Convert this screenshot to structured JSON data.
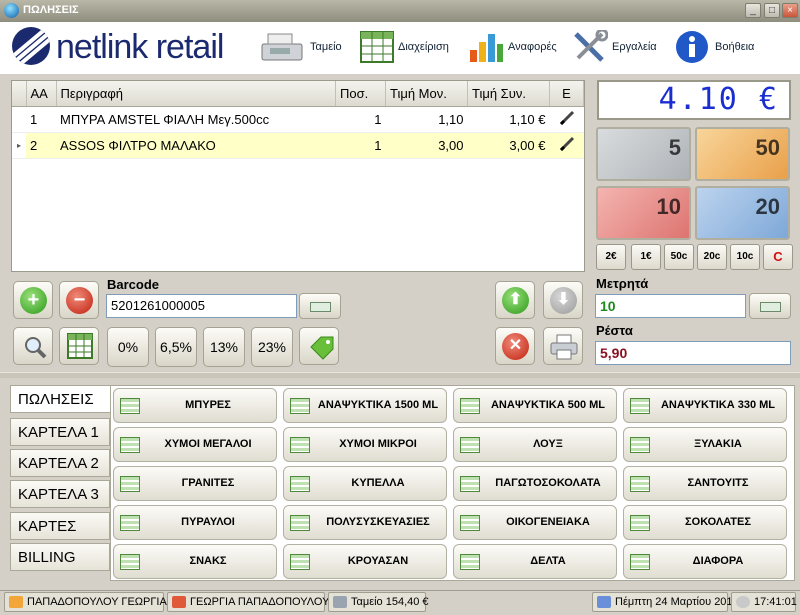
{
  "window": {
    "title": "ΠΩΛΗΣΕΙΣ",
    "min": "_",
    "max": "□",
    "close": "×"
  },
  "brand": {
    "name_a": "netlink ",
    "name_b": "retail"
  },
  "toolbar": [
    {
      "label": "Ταμείο",
      "icon": "cash-register-icon"
    },
    {
      "label": "Διαχείριση",
      "icon": "grid-icon"
    },
    {
      "label": "Αναφορές",
      "icon": "bar-chart-icon"
    },
    {
      "label": "Εργαλεία",
      "icon": "tools-icon"
    },
    {
      "label": "Βοήθεια",
      "icon": "info-icon"
    }
  ],
  "grid": {
    "headers": [
      "AA",
      "Περιγραφή",
      "Ποσ.",
      "Τιμή Μον.",
      "Τιμή Συν.",
      "E"
    ],
    "rows": [
      {
        "aa": "1",
        "desc": "ΜΠΥΡΑ AMSTEL ΦΙΑΛΗ Μεγ.500cc",
        "qty": "1",
        "unit": "1,10",
        "total": "1,10 €"
      },
      {
        "aa": "2",
        "desc": "ASSOS ΦΙΛΤΡΟ ΜΑΛΑΚΟ",
        "qty": "1",
        "unit": "3,00",
        "total": "3,00 €"
      }
    ]
  },
  "display": {
    "total": "4.10 €"
  },
  "notes": [
    {
      "value": "5",
      "color": "#bfc3c6"
    },
    {
      "value": "50",
      "color": "#f2b25c"
    },
    {
      "value": "10",
      "color": "#e98a8a"
    },
    {
      "value": "20",
      "color": "#8cb3dd"
    }
  ],
  "coins": [
    "2€",
    "1€",
    "50c",
    "20c",
    "10c",
    "C"
  ],
  "barcode": {
    "label": "Barcode",
    "value": "5201261000005"
  },
  "vat": [
    "0%",
    "6,5%",
    "13%",
    "23%"
  ],
  "cash": {
    "label": "Μετρητά",
    "value": "10"
  },
  "change": {
    "label": "Ρέστα",
    "value": "5,90"
  },
  "tabs": [
    "ΠΩΛΗΣΕΙΣ",
    "ΚΑΡΤΕΛΑ 1",
    "ΚΑΡΤΕΛΑ 2",
    "ΚΑΡΤΕΛΑ 3",
    "ΚΑΡΤΕΣ",
    "BILLING"
  ],
  "categories": [
    "ΜΠΥΡΕΣ",
    "ΑΝΑΨΥΚΤΙΚΑ 1500 ML",
    "ΑΝΑΨΥΚΤΙΚΑ 500 ML",
    "ΑΝΑΨΥΚΤΙΚΑ 330 ML",
    "ΧΥΜΟΙ ΜΕΓΑΛΟΙ",
    "ΧΥΜΟΙ ΜΙΚΡΟΙ",
    "ΛΟΥΞ",
    "ΞΥΛΑΚΙΑ",
    "ΓΡΑΝΙΤΕΣ",
    "ΚΥΠΕΛΛΑ",
    "ΠΑΓΩΤΟΣΟΚΟΛΑΤΑ",
    "ΣΑΝΤΟΥΙΤΣ",
    "ΠΥΡΑΥΛΟΙ",
    "ΠΟΛΥΣΥΣΚΕΥΑΣΙΕΣ",
    "ΟΙΚΟΓΕΝΕΙΑΚΑ",
    "ΣΟΚΟΛΑΤΕΣ",
    "ΣΝΑΚΣ",
    "ΚΡΟΥΑΣΑΝ",
    "ΔΕΛΤΑ",
    "ΔΙΑΦΟΡΑ"
  ],
  "status": {
    "user1": "ΠΑΠΑΔΟΠΟΥΛΟΥ ΓΕΩΡΓΙΑ",
    "user2": "ΓΕΩΡΓΙΑ ΠΑΠΑΔΟΠΟΥΛΟΥ",
    "cash": "Ταμείο 154,40 €",
    "date": "Πέμπτη 24 Μαρτίου 2011",
    "time": "17:41:01"
  }
}
